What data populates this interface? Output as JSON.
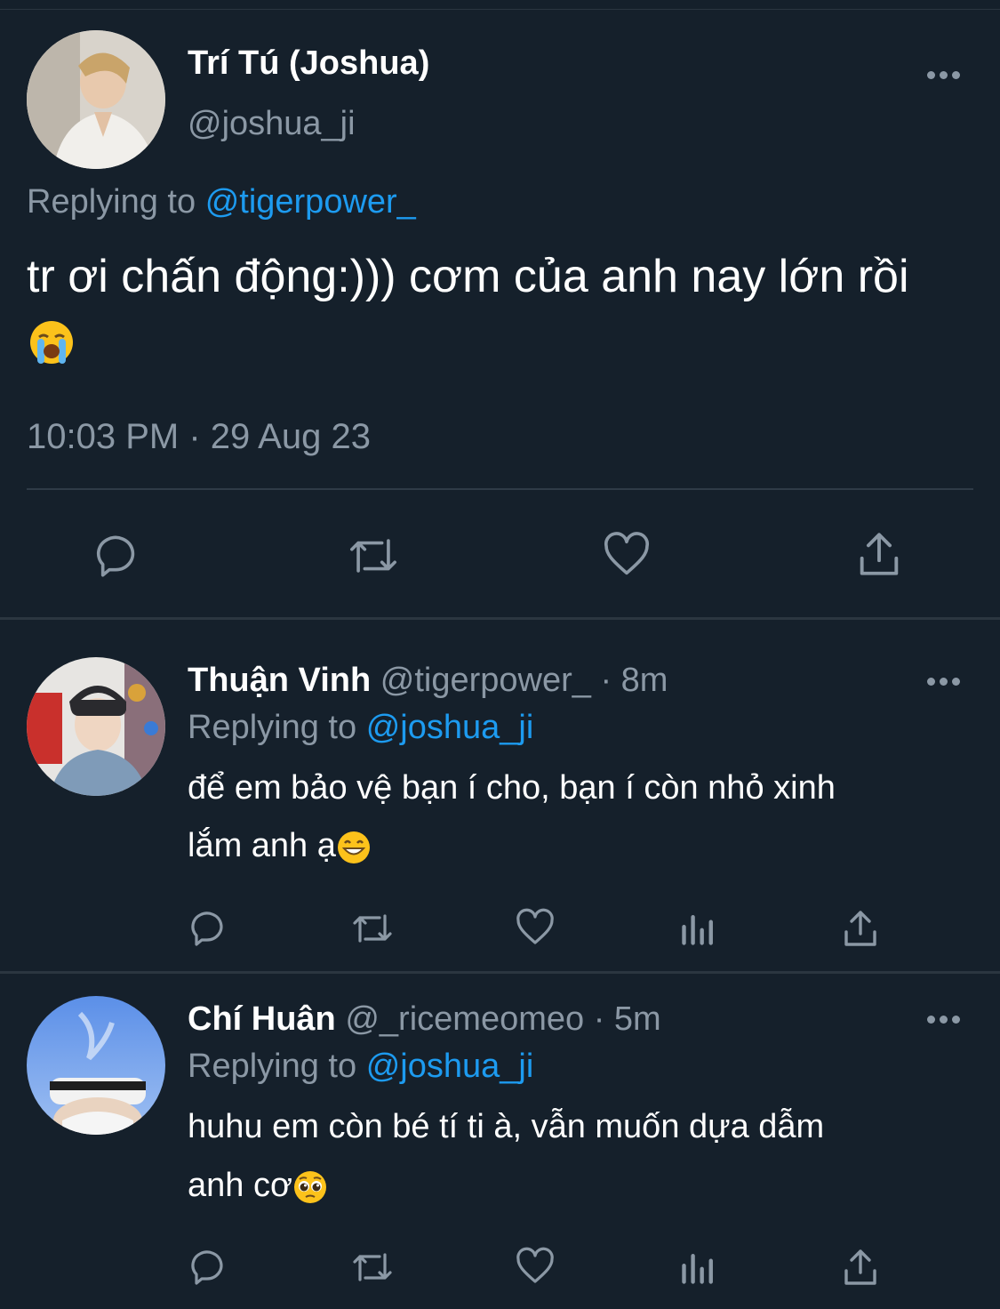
{
  "main_tweet": {
    "display_name": "Trí Tú (Joshua)",
    "handle": "@joshua_ji",
    "replying_prefix": "Replying to",
    "replying_to": "@tigerpower_",
    "text": "tr ơi chấn động:))) cơm của anh nay lớn rồi",
    "emoji": "loudly-crying-face",
    "timestamp": "10:03 PM · 29 Aug 23",
    "actions": [
      "reply-icon",
      "retweet-icon",
      "like-icon",
      "share-icon"
    ]
  },
  "replies": [
    {
      "display_name": "Thuận Vinh",
      "handle": "@tigerpower_",
      "time": "· 8m",
      "replying_prefix": "Replying to",
      "replying_to": "@joshua_ji",
      "line1": "để em bảo vệ bạn í cho, bạn í còn nhỏ xinh",
      "line2": "lắm anh ạ",
      "emoji": "grinning-face",
      "actions": [
        "reply-icon",
        "retweet-icon",
        "like-icon",
        "views-icon",
        "share-icon"
      ]
    },
    {
      "display_name": "Chí Huân",
      "handle": "@_ricemeomeo",
      "time": "· 5m",
      "replying_prefix": "Replying to",
      "replying_to": "@joshua_ji",
      "line1": "huhu em còn bé tí ti à, vẫn muốn dựa dẫm",
      "line2": "anh cơ",
      "emoji": "pleading-face",
      "actions": [
        "reply-icon",
        "retweet-icon",
        "like-icon",
        "views-icon",
        "share-icon"
      ]
    }
  ],
  "colors": {
    "background": "#15202b",
    "accent": "#1d9bf0",
    "muted": "#8b98a5",
    "divider": "#2b3640"
  }
}
